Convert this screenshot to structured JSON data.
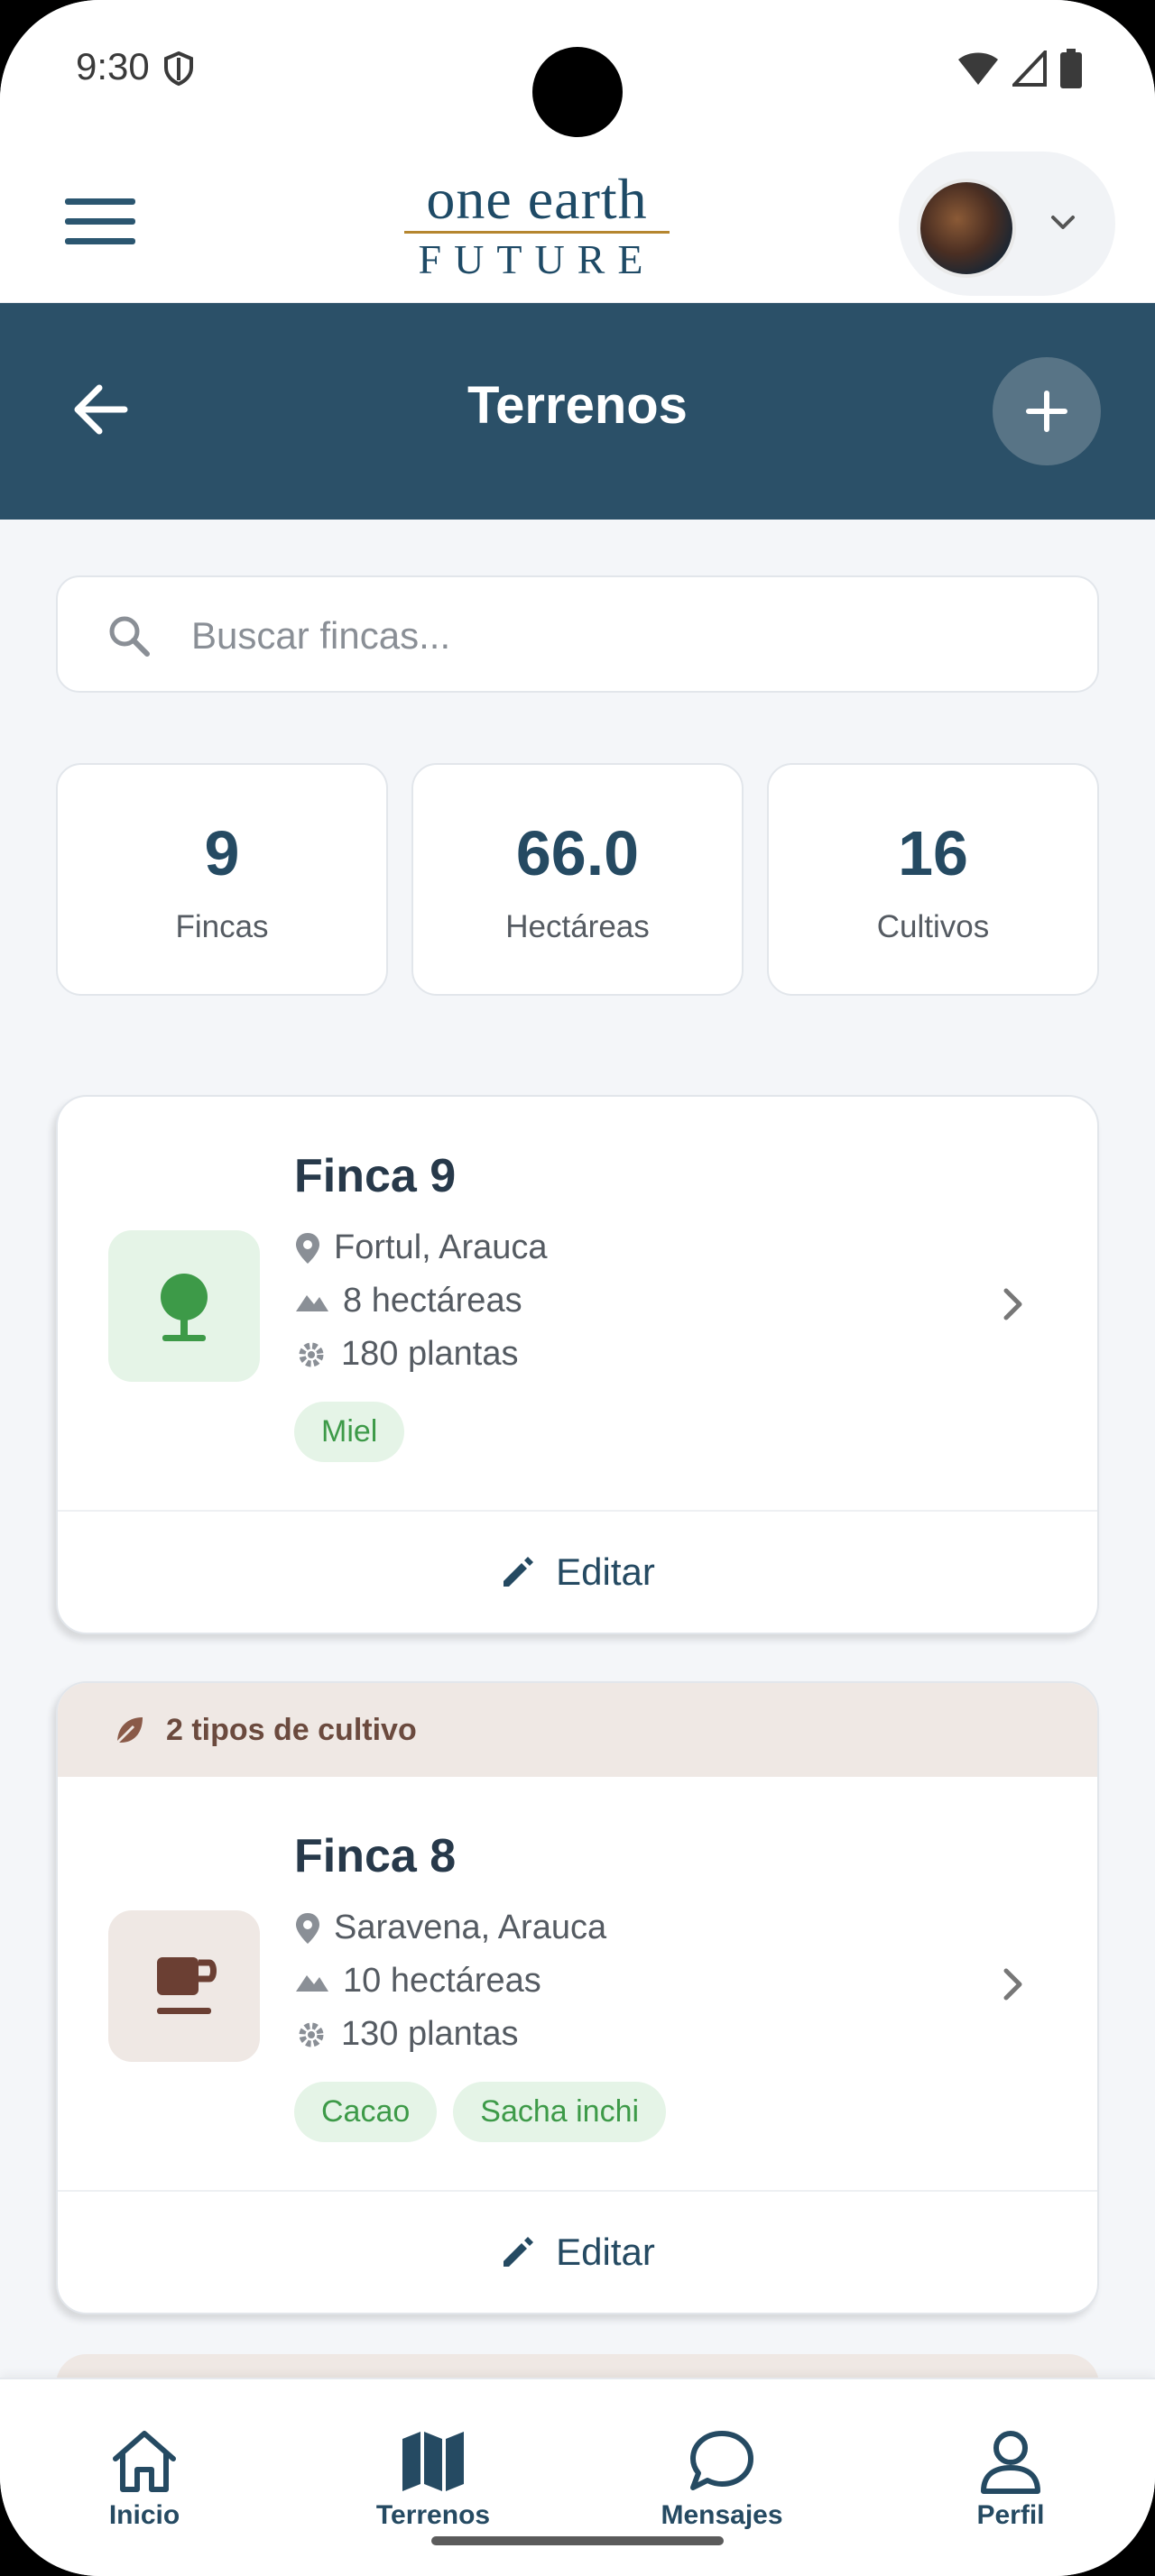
{
  "status_bar": {
    "time": "9:30"
  },
  "header": {
    "logo_top": "one earth",
    "logo_bottom": "FUTURE"
  },
  "title_bar": {
    "title": "Terrenos"
  },
  "search": {
    "placeholder": "Buscar fincas...",
    "value": ""
  },
  "stats": [
    {
      "value": "9",
      "label": "Fincas"
    },
    {
      "value": "66.0",
      "label": "Hectáreas"
    },
    {
      "value": "16",
      "label": "Cultivos"
    }
  ],
  "farms": [
    {
      "name": "Finca 9",
      "location": "Fortul, Arauca",
      "area": "8 hectáreas",
      "plants": "180 plantas",
      "tags": [
        "Miel"
      ],
      "edit_label": "Editar",
      "icon": "tree-icon",
      "color": "#e5f4e7"
    },
    {
      "banner": "2 tipos de cultivo",
      "name": "Finca 8",
      "location": "Saravena, Arauca",
      "area": "10 hectáreas",
      "plants": "130 plantas",
      "tags": [
        "Cacao",
        "Sacha inchi"
      ],
      "edit_label": "Editar",
      "icon": "coffee-cup-icon",
      "color": "#efe8e4"
    }
  ],
  "bottom_nav": [
    {
      "label": "Inicio",
      "icon": "home-icon"
    },
    {
      "label": "Terrenos",
      "icon": "map-icon",
      "active": true
    },
    {
      "label": "Mensajes",
      "icon": "chat-bubble-icon"
    },
    {
      "label": "Perfil",
      "icon": "person-icon"
    }
  ],
  "colors": {
    "primary": "#2b5068",
    "accent_green": "#3d9a48",
    "tag_bg": "#e5f4e7",
    "banner_bg": "#efe8e4"
  }
}
